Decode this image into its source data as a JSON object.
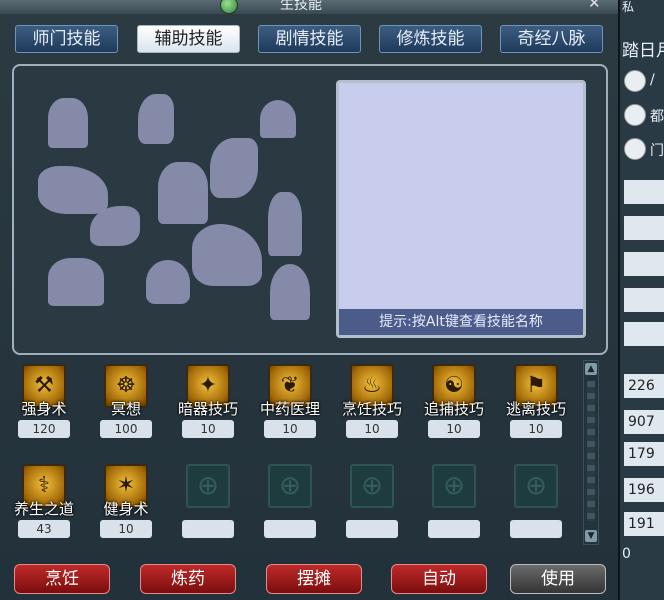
{
  "window": {
    "title": "生技能"
  },
  "tabs": [
    {
      "label": "师门技能",
      "active": false
    },
    {
      "label": "辅助技能",
      "active": true
    },
    {
      "label": "剧情技能",
      "active": false
    },
    {
      "label": "修炼技能",
      "active": false
    },
    {
      "label": "奇经八脉",
      "active": false
    }
  ],
  "preview": {
    "hint": "提示:按Alt键查看技能名称"
  },
  "skills": [
    {
      "name": "强身术",
      "level": "120",
      "icon": "strength-skill-icon",
      "glyph": "⚒"
    },
    {
      "name": "冥想",
      "level": "100",
      "icon": "meditation-skill-icon",
      "glyph": "☸"
    },
    {
      "name": "暗器技巧",
      "level": "10",
      "icon": "dart-skill-icon",
      "glyph": "✦"
    },
    {
      "name": "中药医理",
      "level": "10",
      "icon": "herb-skill-icon",
      "glyph": "❦"
    },
    {
      "name": "烹饪技巧",
      "level": "10",
      "icon": "cooking-skill-icon",
      "glyph": "♨"
    },
    {
      "name": "追捕技巧",
      "level": "10",
      "icon": "pursuit-skill-icon",
      "glyph": "☯"
    },
    {
      "name": "逃离技巧",
      "level": "10",
      "icon": "escape-skill-icon",
      "glyph": "⚑"
    },
    {
      "name": "养生之道",
      "level": "43",
      "icon": "health-skill-icon",
      "glyph": "⚕"
    },
    {
      "name": "健身术",
      "level": "10",
      "icon": "fitness-skill-icon",
      "glyph": "✶"
    },
    {
      "name": "",
      "level": "",
      "icon": "empty-slot-icon",
      "glyph": "⊕"
    },
    {
      "name": "",
      "level": "",
      "icon": "empty-slot-icon",
      "glyph": "⊕"
    },
    {
      "name": "",
      "level": "",
      "icon": "empty-slot-icon",
      "glyph": "⊕"
    },
    {
      "name": "",
      "level": "",
      "icon": "empty-slot-icon",
      "glyph": "⊕"
    },
    {
      "name": "",
      "level": "",
      "icon": "empty-slot-icon",
      "glyph": "⊕"
    }
  ],
  "buttons": {
    "cook": "烹饪",
    "alchemy": "炼药",
    "stall": "摆摊",
    "auto": "自动",
    "use": "使用"
  },
  "right_pane": {
    "title_fragment": "踏日月",
    "top_fragment": "私",
    "labels": [
      "/",
      "都",
      "门"
    ],
    "values": [
      "226",
      "907",
      "179",
      "196",
      "191",
      "0"
    ]
  },
  "colors": {
    "active_tab": "#ffffff",
    "tab": "#2f4f74",
    "red_button": "#a21b1b",
    "gray_button": "#555555",
    "preview_bg": "#c8cdee"
  }
}
